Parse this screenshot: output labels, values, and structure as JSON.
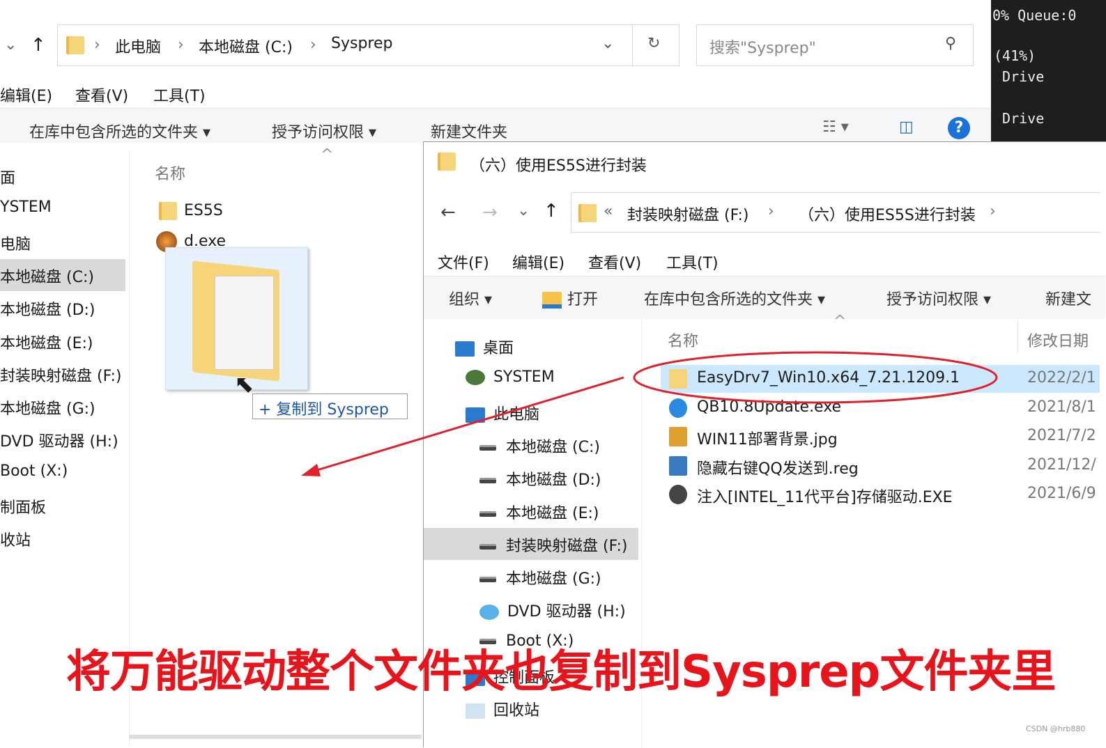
{
  "left_window": {
    "breadcrumb": [
      "此电脑",
      "本地磁盘 (C:)",
      "Sysprep"
    ],
    "search_placeholder": "搜索\"Sysprep\"",
    "menu": [
      "编辑(E)",
      "查看(V)",
      "工具(T)"
    ],
    "toolbar": [
      "在库中包含所选的文件夹 ▾",
      "授予访问权限 ▾",
      "新建文件夹"
    ],
    "nav": [
      "面",
      "YSTEM",
      "电脑",
      "本地磁盘 (C:)",
      "本地磁盘 (D:)",
      "本地磁盘 (E:)",
      "封装映射磁盘 (F:)",
      "本地磁盘 (G:)",
      "DVD 驱动器 (H:)",
      "Boot (X:)",
      "制面板",
      "收站"
    ],
    "nav_selected": 3,
    "column_name": "名称",
    "files": [
      "ES5S",
      "d.exe"
    ],
    "drag_tooltip": "+ 复制到 Sysprep"
  },
  "console": {
    "lines": [
      "0% Queue:0",
      "",
      "(41%)",
      " Drive",
      "",
      " Drive"
    ]
  },
  "right_window": {
    "title": "（六）使用ES5S进行封装",
    "breadcrumb": [
      "«",
      "封装映射磁盘 (F:)",
      "（六）使用ES5S进行封装"
    ],
    "menu": [
      "文件(F)",
      "编辑(E)",
      "查看(V)",
      "工具(T)"
    ],
    "toolbar": [
      "组织 ▾",
      "打开",
      "在库中包含所选的文件夹 ▾",
      "授予访问权限 ▾",
      "新建文"
    ],
    "nav": [
      "桌面",
      "SYSTEM",
      "此电脑",
      "本地磁盘 (C:)",
      "本地磁盘 (D:)",
      "本地磁盘 (E:)",
      "封装映射磁盘 (F:)",
      "本地磁盘 (G:)",
      "DVD 驱动器 (H:)",
      "Boot (X:)",
      "控制面板",
      "回收站"
    ],
    "nav_selected": 6,
    "columns": [
      "名称",
      "修改日期"
    ],
    "files": [
      {
        "name": "EasyDrv7_Win10.x64_7.21.1209.1",
        "date": "2022/2/1",
        "icon": "folder-icon"
      },
      {
        "name": "QB10.8Update.exe",
        "date": "2021/8/1",
        "icon": "app-icon"
      },
      {
        "name": "WIN11部署背景.jpg",
        "date": "2021/7/2",
        "icon": "jpeg-icon"
      },
      {
        "name": "隐藏右键QQ发送到.reg",
        "date": "2021/12/",
        "icon": "reg-icon"
      },
      {
        "name": "注入[INTEL_11代平台]存储驱动.EXE",
        "date": "2021/6/9",
        "icon": "exe-icon"
      }
    ]
  },
  "annotation": {
    "caption": "将万能驱动整个文件夹也复制到Sysprep文件夹里",
    "color": "#e8141c"
  },
  "watermark": "CSDN @hrb880"
}
